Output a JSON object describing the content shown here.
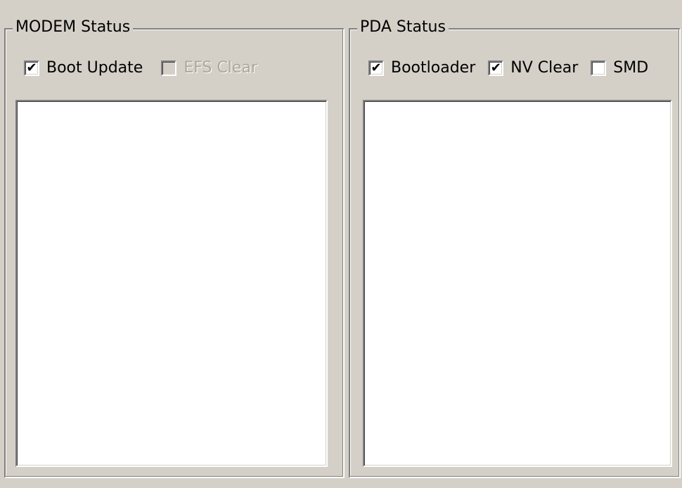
{
  "modem": {
    "title": "MODEM Status",
    "options": [
      {
        "label": "Boot Update",
        "checked": true,
        "enabled": true,
        "mark": "✔"
      },
      {
        "label": "EFS Clear",
        "checked": false,
        "enabled": false,
        "mark": ""
      }
    ]
  },
  "pda": {
    "title": "PDA Status",
    "options": [
      {
        "label": "Bootloader",
        "checked": true,
        "enabled": true,
        "mark": "✔"
      },
      {
        "label": "NV Clear",
        "checked": true,
        "enabled": true,
        "mark": "✔"
      },
      {
        "label": "SMD",
        "checked": false,
        "enabled": true,
        "mark": ""
      }
    ]
  },
  "colors": {
    "window_bg": "#d4d0c8",
    "list_bg": "#ffffff",
    "disabled_text": "#aca899"
  }
}
